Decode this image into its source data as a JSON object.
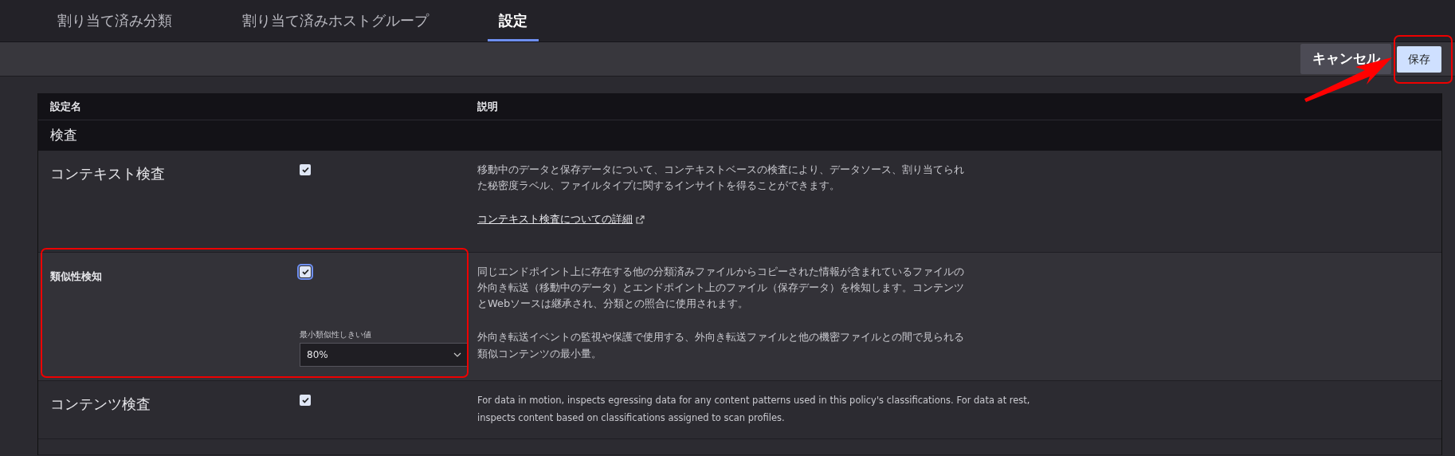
{
  "tabs": [
    {
      "label": "割り当て済み分類",
      "selected": false
    },
    {
      "label": "割り当て済みホストグループ",
      "selected": false
    },
    {
      "label": "設定",
      "selected": true
    }
  ],
  "toolbar": {
    "buttons": [
      {
        "label": "キャンセル",
        "kind": "secondary",
        "highlighted": false
      },
      {
        "label": "保存",
        "kind": "primary",
        "highlighted": true
      }
    ]
  },
  "table": {
    "columns": [
      "設定名",
      "説明"
    ],
    "section": "検査",
    "rows": [
      {
        "kind": "main",
        "name": "コンテキスト検査",
        "checked": true,
        "focused": false,
        "highlighted": false,
        "description": [
          "移動中のデータと保存データについて、コンテキストベースの検査により、データソース、割り当てられた秘密度ラベル、ファイルタイプに関するインサイトを得ることができます。"
        ],
        "link": "コンテキスト検査についての詳細"
      },
      {
        "kind": "threshold",
        "name": "類似性検知",
        "checked": true,
        "focused": true,
        "highlighted": true,
        "description": [
          "同じエンドポイント上に存在する他の分類済みファイルからコピーされた情報が含まれているファイルの外向き転送（移動中のデータ）とエンドポイント上のファイル（保存データ）を検知します。コンテンツとWebソースは継承され、分類との照合に使用されます。",
          "外向き転送イベントの監視や保護で使用する、外向き転送ファイルと他の機密ファイルとの間で見られる類似コンテンツの最小量。"
        ],
        "select": {
          "label": "最小類似性しきい値",
          "value": "80%"
        }
      },
      {
        "kind": "main",
        "name": "コンテンツ検査",
        "checked": true,
        "focused": false,
        "highlighted": false,
        "small_description": true,
        "description": [
          "For data in motion, inspects egressing data for any content patterns used in this policy's classifications. For data at rest, inspects content based on classifications assigned to scan profiles."
        ]
      }
    ]
  }
}
